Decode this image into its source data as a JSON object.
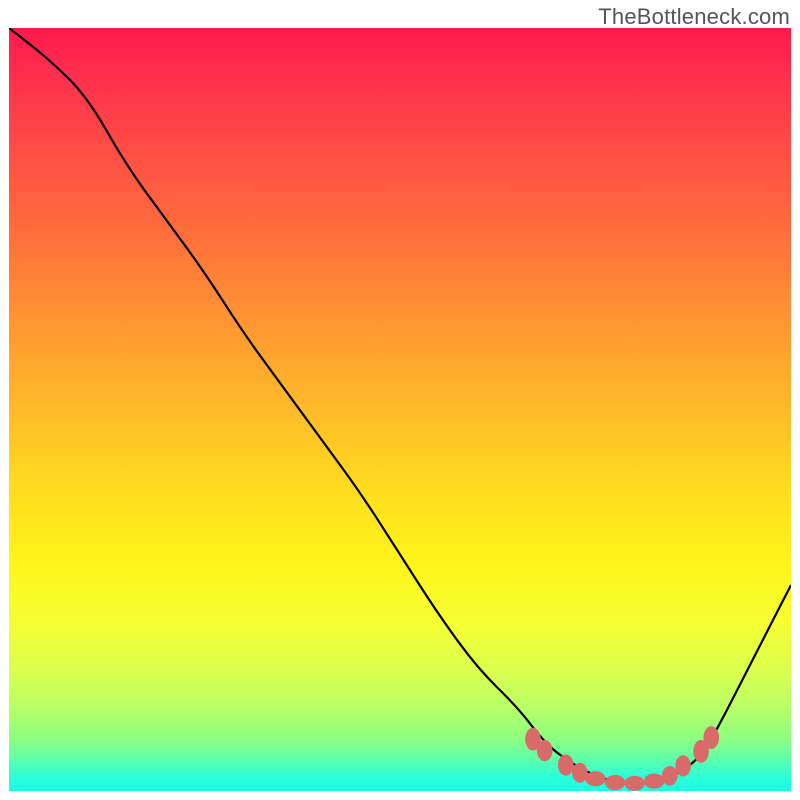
{
  "watermark": "TheBottleneck.com",
  "chart_data": {
    "type": "line",
    "title": "",
    "xlabel": "",
    "ylabel": "",
    "xlim": [
      0,
      100
    ],
    "ylim": [
      0,
      100
    ],
    "grid": false,
    "series": [
      {
        "name": "bottleneck-curve",
        "x": [
          0,
          5,
          10,
          15,
          20,
          25,
          30,
          35,
          40,
          45,
          50,
          55,
          60,
          65,
          68,
          70,
          73,
          75,
          78,
          80,
          83,
          85,
          88,
          90,
          95,
          100
        ],
        "values": [
          100,
          96,
          91,
          82,
          75,
          68,
          60,
          53,
          46,
          39,
          31,
          23,
          16,
          11,
          7,
          5,
          3,
          2,
          1,
          1,
          1,
          2,
          4,
          7,
          17,
          27
        ]
      }
    ],
    "markers": [
      {
        "x": 67.0,
        "y": 6.8,
        "rx": 1.0,
        "ry": 1.5
      },
      {
        "x": 68.5,
        "y": 5.3,
        "rx": 1.0,
        "ry": 1.4
      },
      {
        "x": 71.2,
        "y": 3.4,
        "rx": 1.0,
        "ry": 1.4
      },
      {
        "x": 73.0,
        "y": 2.4,
        "rx": 1.0,
        "ry": 1.3
      },
      {
        "x": 75.0,
        "y": 1.6,
        "rx": 1.3,
        "ry": 1.0
      },
      {
        "x": 77.5,
        "y": 1.1,
        "rx": 1.3,
        "ry": 1.0
      },
      {
        "x": 80.0,
        "y": 1.0,
        "rx": 1.3,
        "ry": 1.0
      },
      {
        "x": 82.5,
        "y": 1.3,
        "rx": 1.3,
        "ry": 1.0
      },
      {
        "x": 84.5,
        "y": 2.0,
        "rx": 1.0,
        "ry": 1.3
      },
      {
        "x": 86.2,
        "y": 3.3,
        "rx": 1.0,
        "ry": 1.4
      },
      {
        "x": 88.5,
        "y": 5.2,
        "rx": 1.0,
        "ry": 1.5
      },
      {
        "x": 89.8,
        "y": 7.0,
        "rx": 1.0,
        "ry": 1.5
      }
    ]
  }
}
